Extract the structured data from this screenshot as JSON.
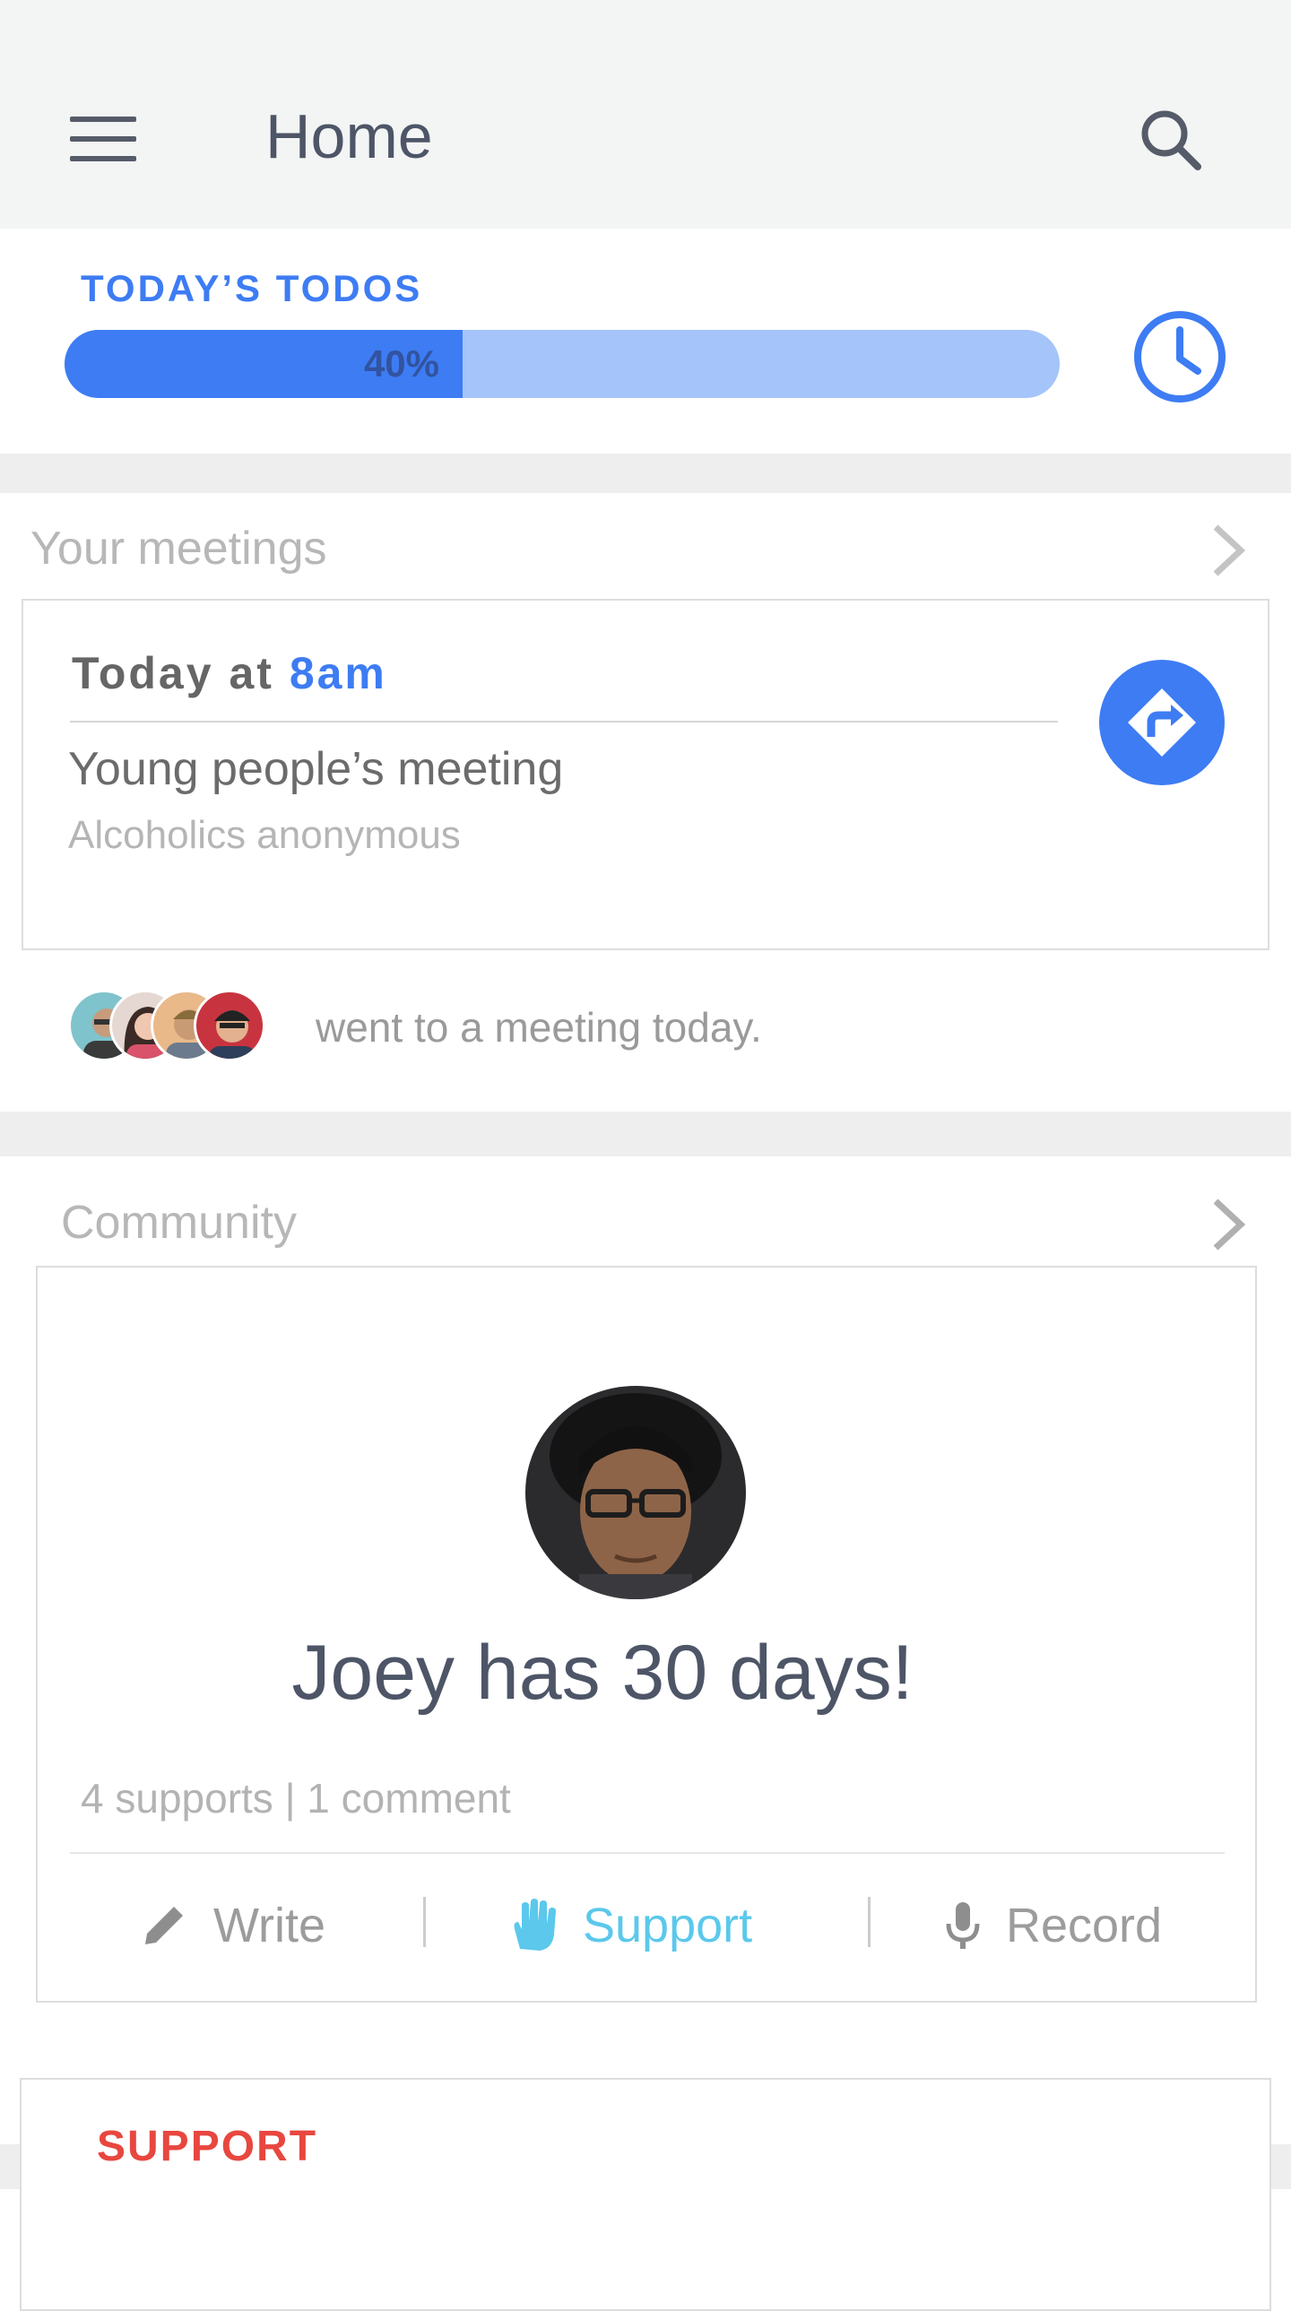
{
  "app_bar": {
    "title": "Home",
    "menu_icon": "hamburger-menu-icon",
    "search_icon": "search-icon"
  },
  "todos": {
    "label": "TODAY’S TODOS",
    "progress": 0.4,
    "progress_text": "40%",
    "clock_icon": "clock-icon"
  },
  "meetings": {
    "section_title": "Your meetings",
    "card": {
      "day": "Today",
      "at": "at",
      "time": "8am",
      "name": "Young people’s meeting",
      "organization": "Alcoholics anonymous",
      "directions_icon": "directions-icon"
    },
    "attendees_text": "went to a meeting today."
  },
  "community": {
    "section_title": "Community",
    "headline": "Joey has 30 days!",
    "stats": "4 supports | 1 comment",
    "actions": [
      {
        "label": "Write",
        "icon": "pencil-icon"
      },
      {
        "label": "Support",
        "icon": "raised-hand-icon"
      },
      {
        "label": "Record",
        "icon": "microphone-icon"
      }
    ]
  },
  "support": {
    "label": "SUPPORT"
  },
  "colors": {
    "accent": "#3d7cf3",
    "progress_track": "#a4c4fa",
    "support_active": "#5bc8ec",
    "alert": "#e8473f",
    "app_bar_bg": "#f3f4f4",
    "band_bg": "#eeeeee"
  }
}
